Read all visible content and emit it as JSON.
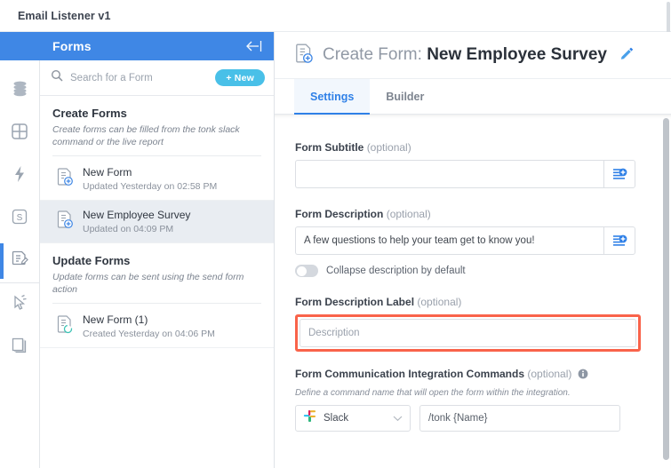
{
  "topbar": {
    "title": "Email Listener v1"
  },
  "rail": {
    "items": [
      {
        "name": "database-icon",
        "label": "Database"
      },
      {
        "name": "grid-icon",
        "label": "Tables"
      },
      {
        "name": "bolt-icon",
        "label": "Actions"
      },
      {
        "name": "s-badge-icon",
        "label": "S"
      },
      {
        "name": "form-edit-icon",
        "label": "Forms"
      },
      {
        "name": "cursor-click-icon",
        "label": "Triggers"
      },
      {
        "name": "layers-icon",
        "label": "Pages"
      }
    ],
    "active_index": 4,
    "s_badge_text": "S"
  },
  "panel": {
    "title": "Forms",
    "collapse_icon": "collapse-left-icon",
    "search": {
      "placeholder": "Search for a Form",
      "value": ""
    },
    "new_button": "+ New",
    "groups": [
      {
        "title": "Create Forms",
        "subtitle": "Create forms can be filled from the tonk slack command or the live report",
        "items": [
          {
            "name": "New Form",
            "meta": "Updated Yesterday on 02:58 PM",
            "icon": "form-add-icon",
            "selected": false
          },
          {
            "name": "New Employee Survey",
            "meta": "Updated on 04:09 PM",
            "icon": "form-add-icon",
            "selected": true
          }
        ]
      },
      {
        "title": "Update Forms",
        "subtitle": "Update forms can be sent using the send form action",
        "items": [
          {
            "name": "New Form (1)",
            "meta": "Created Yesterday on 04:06 PM",
            "icon": "form-sync-icon",
            "selected": false
          }
        ]
      }
    ]
  },
  "main": {
    "header": {
      "icon": "form-add-icon",
      "prefix": "Create Form:",
      "form_name": "New Employee Survey",
      "edit_icon": "pencil-icon"
    },
    "tabs": [
      {
        "label": "Settings",
        "active": true
      },
      {
        "label": "Builder",
        "active": false
      }
    ],
    "fields": {
      "subtitle": {
        "label": "Form Subtitle",
        "optional": "(optional)",
        "value": "",
        "placeholder": "",
        "insert_icon": "insert-variable-icon"
      },
      "description": {
        "label": "Form Description",
        "optional": "(optional)",
        "value": "A few questions to help your team get to know you!",
        "placeholder": "",
        "insert_icon": "insert-variable-icon",
        "toggle_label": "Collapse description by default",
        "toggle_on": false
      },
      "description_label": {
        "label": "Form Description Label",
        "optional": "(optional)",
        "value": "",
        "placeholder": "Description",
        "highlight_color": "#f9634a"
      },
      "integration_commands": {
        "label": "Form Communication Integration Commands",
        "optional": "(optional)",
        "info_icon": "info-icon",
        "hint": "Define a command name that will open the form within the integration.",
        "select_value": "Slack",
        "select_icon": "slack-icon",
        "chevron_icon": "chevron-down-icon",
        "command_value": "/tonk {Name}",
        "command_placeholder": ""
      }
    }
  },
  "colors": {
    "brand_blue": "#3f87e5",
    "accent_cyan": "#49c0e8",
    "highlight_red": "#f9634a",
    "tab_blue": "#2f80e7"
  }
}
